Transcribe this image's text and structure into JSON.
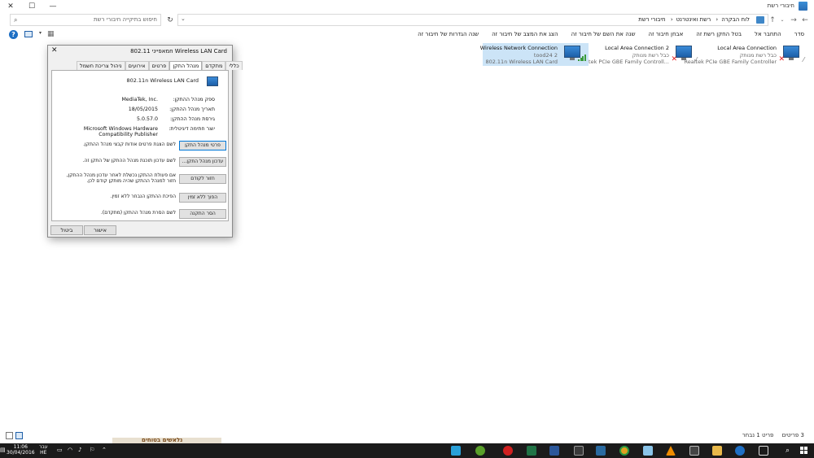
{
  "window": {
    "title": "חיבורי רשת",
    "minimize": "—",
    "maximize": "☐",
    "close": "✕"
  },
  "address": {
    "crumbs": [
      "לוח הבקרה",
      "רשת ואינטרנט",
      "חיבורי רשת"
    ],
    "search_placeholder": "חיפוש בתיקייה חיבורי רשת"
  },
  "commands": [
    "סדר",
    "התחבר אל",
    "בטל החקן רשת זה",
    "אבחן חיבור זה",
    "שנה את השם של חיבור זה",
    "הצג את המצב של חיבור זה",
    "שנה הגדרות של חיבור זה"
  ],
  "connections": [
    {
      "name": "Local Area Connection",
      "status": "כבל רשת מנותק",
      "device": "Realtek PCIe GBE Family Controller",
      "state": "disconnected"
    },
    {
      "name": "Local Area Connection 2",
      "status": "כבל רשת מנותק",
      "device": "Realtek PCIe GBE Family Controll...",
      "state": "disconnected"
    },
    {
      "name": "Wireless Network Connection",
      "status": "tood24 2",
      "device": "802.11n Wireless LAN Card",
      "state": "connected"
    }
  ],
  "status": {
    "items": "3 פריטים",
    "selected": "פריט 1 נבחר"
  },
  "dialog": {
    "title": "מאפייני 802.11n Wireless LAN Card",
    "tabs": [
      "כללי",
      "מתקדם",
      "מנהל התקן",
      "פרטים",
      "אירועים",
      "ניהול צריכת חשמל"
    ],
    "active_tab": "מנהל התקן",
    "device_name": "802.11n Wireless LAN Card",
    "properties": [
      {
        "label": "ספק מנהל ההתקן:",
        "value": "MediaTek, Inc."
      },
      {
        "label": "תאריך מנהל ההתקן:",
        "value": "18/05/2015"
      },
      {
        "label": "גירסת מנהל ההתקן:",
        "value": "5.0.57.0"
      },
      {
        "label": "יוצר חתימה דיגיטלית:",
        "value": "Microsoft Windows Hardware Compatibility Publisher"
      }
    ],
    "buttons": [
      {
        "label": "פרטי מנהל התקן",
        "desc": "לשם הצגת פרטים אודות קבצי מנהל ההתקן."
      },
      {
        "label": "עדכון מנהל התקן...",
        "desc": "לשם עדכון תוכנת מנהל ההתקן של התקן זה."
      },
      {
        "label": "חזור לקודם",
        "desc": "אם פעולת ההתקן נכשלת לאחר עדכון מנהל ההתקן, חזור למנהל ההתקן שהיה מותקן קודם לכן."
      },
      {
        "label": "הפוך ללא זמין",
        "desc": "הפיכת ההתקן הנבחר ללא זמין."
      },
      {
        "label": "הסר התקנה",
        "desc": "לשם הסרת מנהל ההתקן (מתקדם)."
      }
    ],
    "ok": "אישור",
    "cancel": "ביטול"
  },
  "taskbar": {
    "time": "11:06",
    "date": "30/04/2016",
    "lang_top": "עבר",
    "lang_bottom": "HE",
    "thumb_text": "נלאשים בטוחים"
  },
  "colors": {
    "selection": "#cce4f7",
    "accent": "#0078d7",
    "taskbar": "#1b1b1b"
  }
}
